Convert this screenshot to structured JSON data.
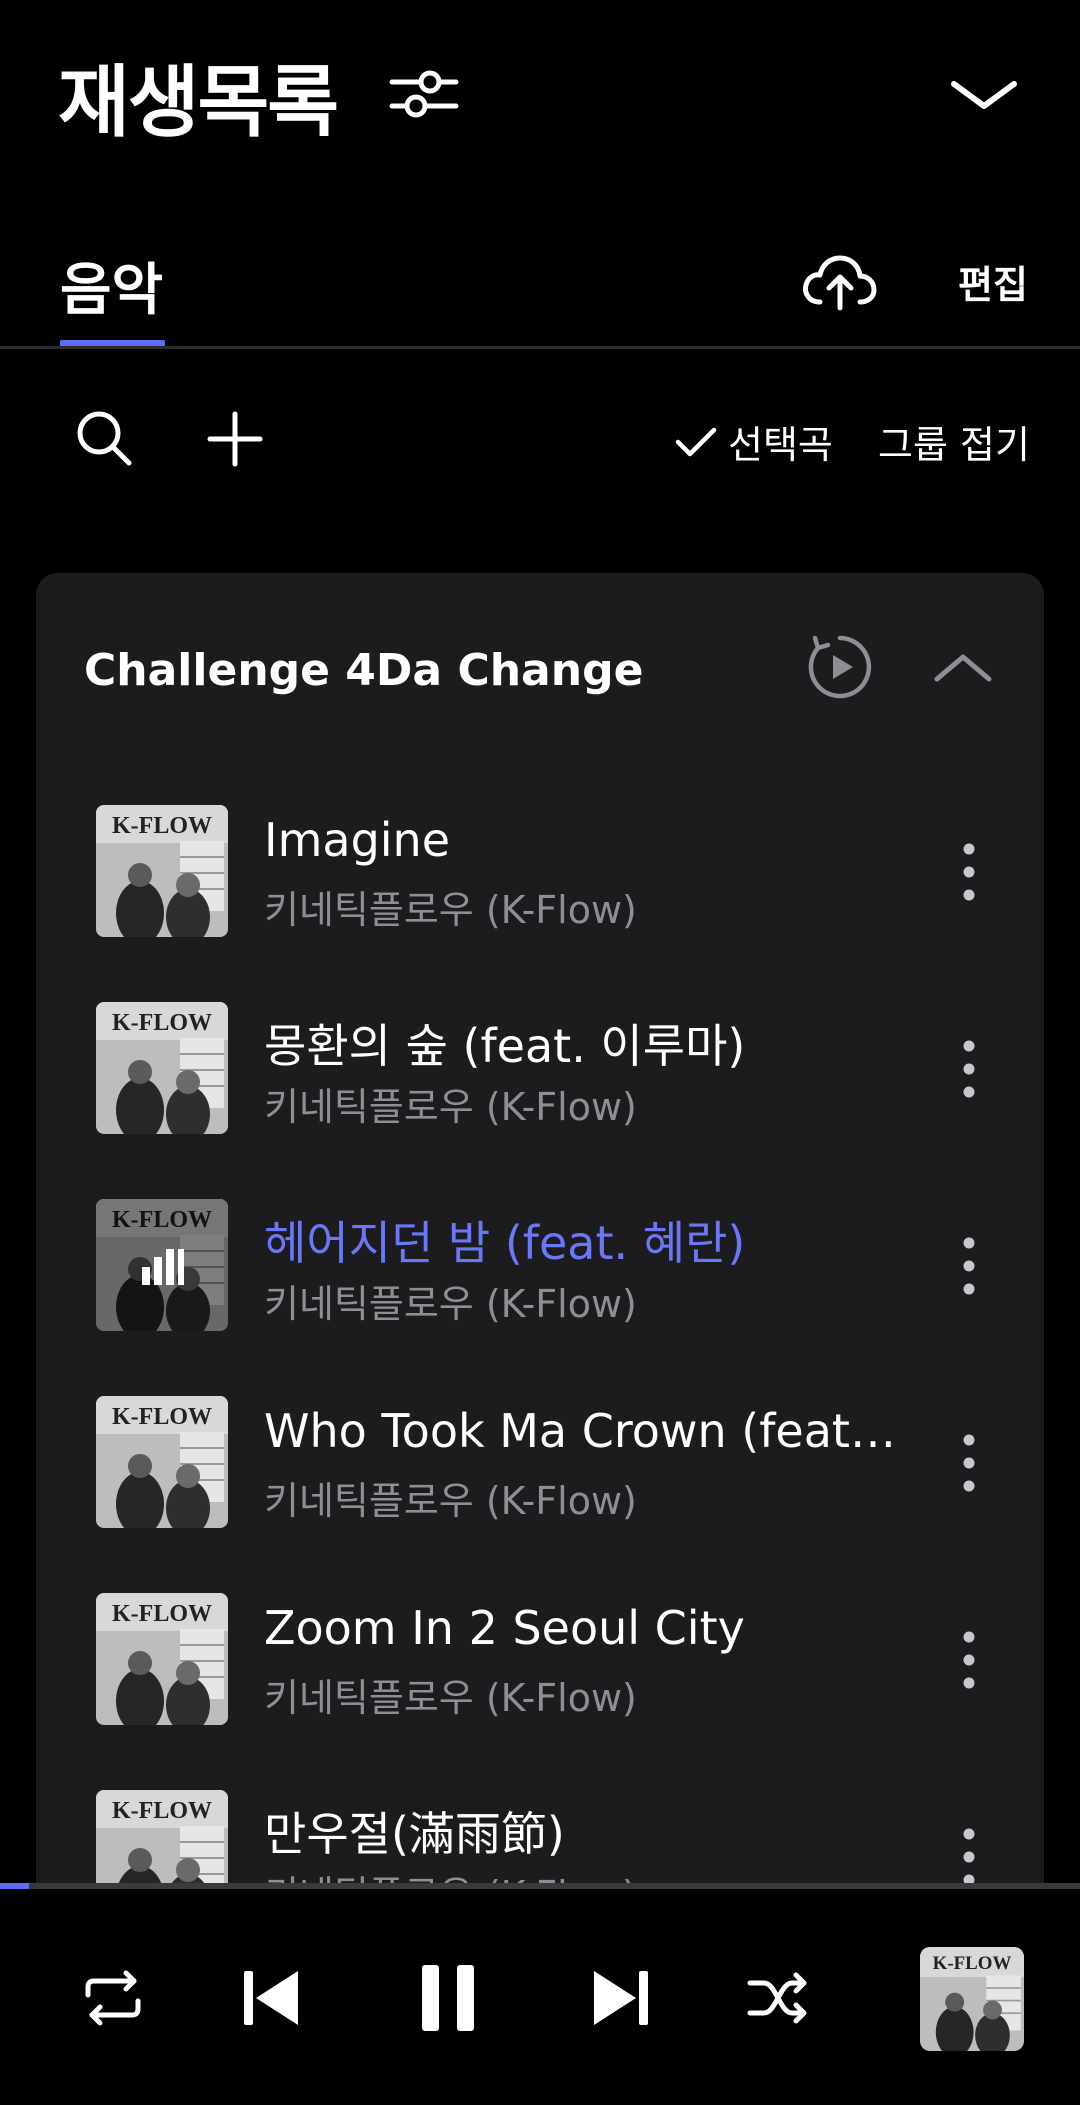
{
  "header": {
    "title": "재생목록",
    "filter_icon": "sliders-icon",
    "collapse_icon": "chevron-down-icon"
  },
  "tabs": {
    "music_label": "음악",
    "upload_icon": "cloud-upload-icon",
    "edit_label": "편집"
  },
  "toolbar": {
    "select_label": "선택곡",
    "group_fold_label": "그룹 접기"
  },
  "group": {
    "title": "Challenge 4Da Change",
    "tracks": [
      {
        "title": "Imagine",
        "artist": "키네틱플로우 (K-Flow)",
        "playing": false
      },
      {
        "title": "몽환의 숲 (feat. 이루마)",
        "artist": "키네틱플로우 (K-Flow)",
        "playing": false
      },
      {
        "title": "헤어지던 밤 (feat. 혜란)",
        "artist": "키네틱플로우 (K-Flow)",
        "playing": true
      },
      {
        "title": "Who Took Ma Crown (feat....",
        "artist": "키네틱플로우 (K-Flow)",
        "playing": false
      },
      {
        "title": "Zoom In 2 Seoul City",
        "artist": "키네틱플로우 (K-Flow)",
        "playing": false
      },
      {
        "title": "만우절(滿雨節)",
        "artist": "키네틱플로우 (K-Flow)",
        "playing": false
      }
    ]
  },
  "player": {
    "progress_fraction": 0.027,
    "accent_color": "#5b6ef5"
  },
  "album_art_text": "K-FLOW"
}
